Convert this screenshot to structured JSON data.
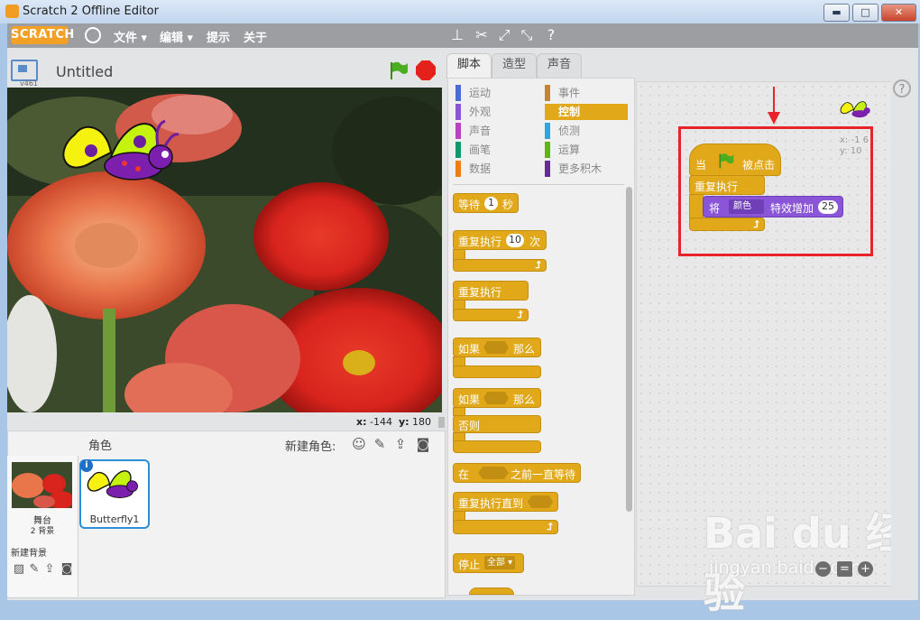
{
  "window": {
    "title": "Scratch 2 Offline Editor",
    "minimize": "▬",
    "maximize": "□",
    "close": "✕"
  },
  "menubar": {
    "logo": "SCRATCH",
    "items": [
      "文件 ▾",
      "编辑 ▾",
      "提示",
      "关于"
    ],
    "tools": [
      "duplicate-icon",
      "delete-icon",
      "grow-icon",
      "shrink-icon",
      "help-icon"
    ]
  },
  "stage": {
    "version": "v461",
    "title": "Untitled",
    "x_label": "x:",
    "x_value": "-144",
    "y_label": "y:",
    "y_value": "180"
  },
  "sprites_pane": {
    "title": "角色",
    "new_sprite": "新建角色:",
    "stage_name": "舞台",
    "bg_count": "2 背景",
    "new_bg": "新建背景",
    "sprite_name": "Butterfly1"
  },
  "tabs": [
    "脚本",
    "造型",
    "声音"
  ],
  "categories": {
    "left": [
      {
        "label": "运动",
        "color": "#4a6cd4"
      },
      {
        "label": "外观",
        "color": "#8a55d7"
      },
      {
        "label": "声音",
        "color": "#bb42c3"
      },
      {
        "label": "画笔",
        "color": "#0e9a6c"
      },
      {
        "label": "数据",
        "color": "#ee7d16"
      }
    ],
    "right": [
      {
        "label": "事件",
        "color": "#c88330"
      },
      {
        "label": "控制",
        "color": "#e1a91a"
      },
      {
        "label": "侦测",
        "color": "#2ca5e2"
      },
      {
        "label": "运算",
        "color": "#5cb712"
      },
      {
        "label": "更多积木",
        "color": "#632d99"
      }
    ]
  },
  "blocks": {
    "wait": "等待",
    "wait_value": "1",
    "wait_unit": "秒",
    "repeat": "重复执行",
    "repeat_value": "10",
    "repeat_unit": "次",
    "forever": "重复执行",
    "if": "如果",
    "then": "那么",
    "if2": "如果",
    "then2": "那么",
    "else": "否则",
    "wait_until_a": "在",
    "wait_until_b": "之前一直等待",
    "repeat_until": "重复执行直到",
    "stop": "停止",
    "stop_option": "全部 ▾"
  },
  "script": {
    "hat_a": "当",
    "hat_b": "被点击",
    "forever": "重复执行",
    "change_a": "将",
    "effect": "颜色",
    "change_b": "特效增加",
    "change_value": "25"
  },
  "sprite_info": {
    "x": "x: -1 6",
    "y": "y: 10"
  },
  "watermark": {
    "main": "Bai du 经验",
    "sub": "jingyan.baidu.com"
  }
}
